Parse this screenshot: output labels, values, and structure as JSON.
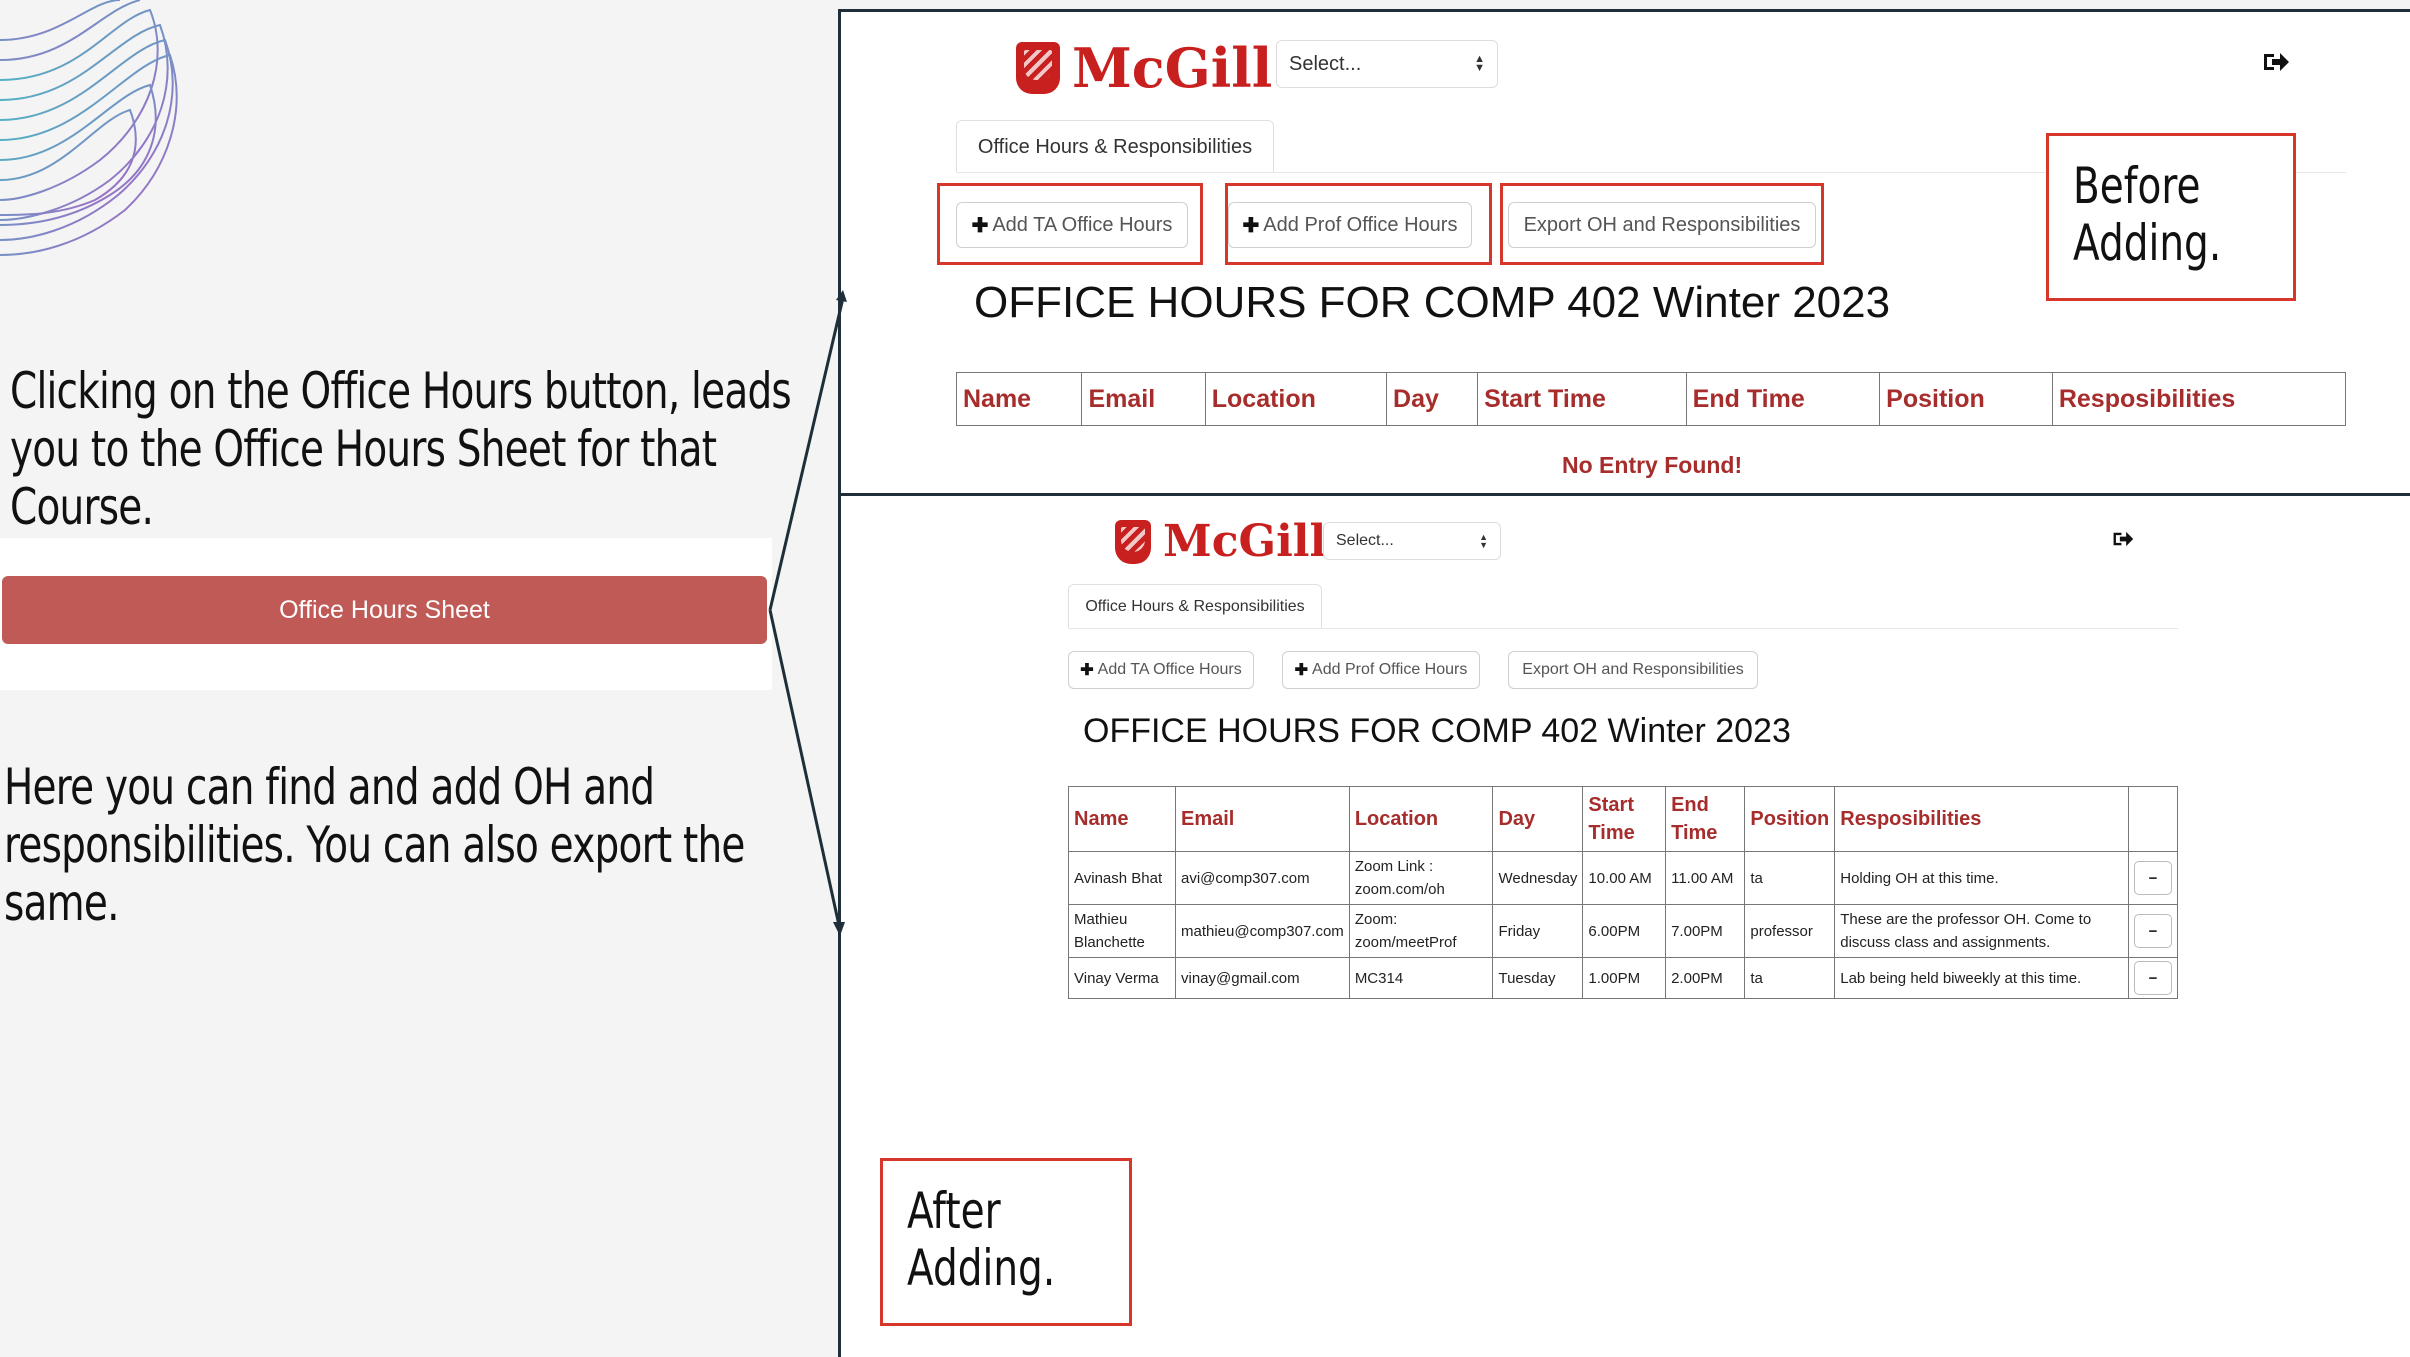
{
  "left": {
    "intro_line1": "Clicking on the Office Hours button, leads",
    "intro_line2": "you to the Office Hours Sheet for that",
    "intro_line3": "Course.",
    "button_label": "Office Hours Sheet",
    "desc_line1": "Here you can find and add OH and",
    "desc_line2": "responsibilities. You can also export the",
    "desc_line3": "same."
  },
  "before": {
    "logo": "McGill",
    "select_value": "Select...",
    "tab": "Office Hours & Responsibilities",
    "btn_add_ta": "Add TA Office Hours",
    "btn_add_prof": "Add Prof Office Hours",
    "btn_export": "Export OH and Responsibilities",
    "heading": "OFFICE HOURS FOR COMP 402 Winter 2023",
    "columns": [
      "Name",
      "Email",
      "Location",
      "Day",
      "Start Time",
      "End Time",
      "Position",
      "Resposibilities"
    ],
    "empty_message": "No Entry Found!",
    "note_line1": "Before",
    "note_line2": "Adding."
  },
  "after": {
    "logo": "McGill",
    "select_value": "Select...",
    "tab": "Office Hours & Responsibilities",
    "btn_add_ta": "Add TA Office Hours",
    "btn_add_prof": "Add Prof Office Hours",
    "btn_export": "Export OH and Responsibilities",
    "heading": "OFFICE HOURS FOR COMP 402 Winter 2023",
    "columns": [
      "Name",
      "Email",
      "Location",
      "Day",
      "Start Time",
      "End Time",
      "Position",
      "Resposibilities"
    ],
    "rows": [
      {
        "name": "Avinash Bhat",
        "email": "avi@comp307.com",
        "location": "Zoom Link : zoom.com/oh",
        "day": "Wednesday",
        "start": "10.00 AM",
        "end": "11.00 AM",
        "position": "ta",
        "resp": "Holding OH at this time."
      },
      {
        "name": "Mathieu Blanchette",
        "email": "mathieu@comp307.com",
        "location": "Zoom: zoom/meetProf",
        "day": "Friday",
        "start": "6.00PM",
        "end": "7.00PM",
        "position": "professor",
        "resp": "These are the professor OH. Come to discuss class and assignments."
      },
      {
        "name": "Vinay Verma",
        "email": "vinay@gmail.com",
        "location": "MC314",
        "day": "Tuesday",
        "start": "1.00PM",
        "end": "2.00PM",
        "position": "ta",
        "resp": "Lab being held biweekly at this time."
      }
    ],
    "note_line1": "After",
    "note_line2": "Adding."
  },
  "colors": {
    "accent_red": "#c8201f",
    "button_red": "#c05a56",
    "outline_red": "#d7362b",
    "header_text": "#a62d2b"
  },
  "icons": [
    "shield-logo-icon",
    "logout-icon",
    "plus-icon",
    "minus-icon",
    "select-arrows-icon",
    "wave-decoration"
  ]
}
